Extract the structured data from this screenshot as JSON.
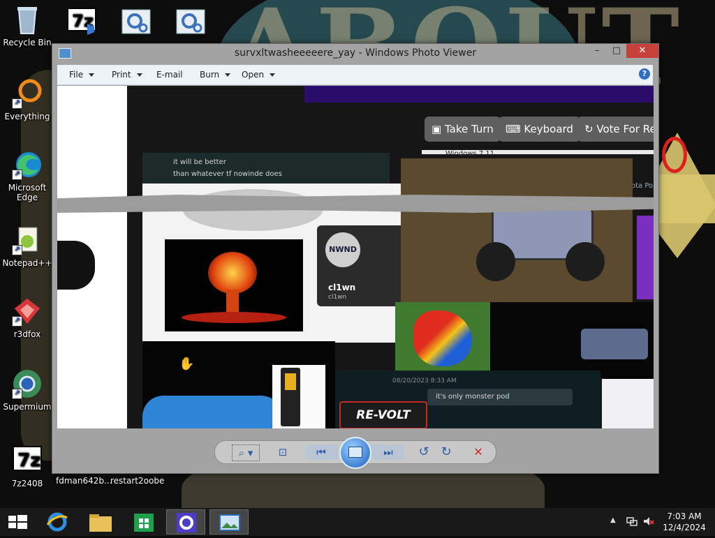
{
  "desktop": {
    "icons": [
      {
        "label": "Recycle Bin"
      },
      {
        "label": "Everything"
      },
      {
        "label": "Microsoft Edge"
      },
      {
        "label": "Notepad++"
      },
      {
        "label": "r3dfox"
      },
      {
        "label": "Supermium"
      },
      {
        "label": "7z2408"
      },
      {
        "label": "fdman642b..."
      },
      {
        "label": "restart2oobe"
      }
    ],
    "top_icons": [
      "7z",
      "",
      ""
    ]
  },
  "window": {
    "title": "survxltwasheeeeere_yay - Windows Photo Viewer",
    "controls": {
      "minimize": "–",
      "maximize": "□",
      "close": "✕"
    },
    "menu": {
      "file": "File",
      "print": "Print",
      "email": "E-mail",
      "burn": "Burn",
      "open": "Open",
      "help": "?"
    }
  },
  "image": {
    "buttons": {
      "take_turn": "Take Turn",
      "keyboard": "Keyboard",
      "vote": "Vote For Re"
    },
    "chat_lines": [
      "it will be better",
      "than whatever tf nowinde does"
    ],
    "user_card": {
      "name": "cl1wn",
      "sub": "cl1wn",
      "avatar_text": "NWND"
    },
    "revolt": "RE-VOLT",
    "message": "it's only monster pod",
    "date": "08/20/2023 8:33 AM",
    "small_text": "Windows 7 11",
    "side_text": "ota Po"
  },
  "controlbar": {
    "zoom": "⌕",
    "fit": "⊡",
    "prev": "⏮",
    "next": "⏭",
    "rotate_ccw": "↺",
    "rotate_cw": "↻",
    "delete": "✕"
  },
  "taskbar": {
    "time": "7:03 AM",
    "date": "12/4/2024"
  }
}
